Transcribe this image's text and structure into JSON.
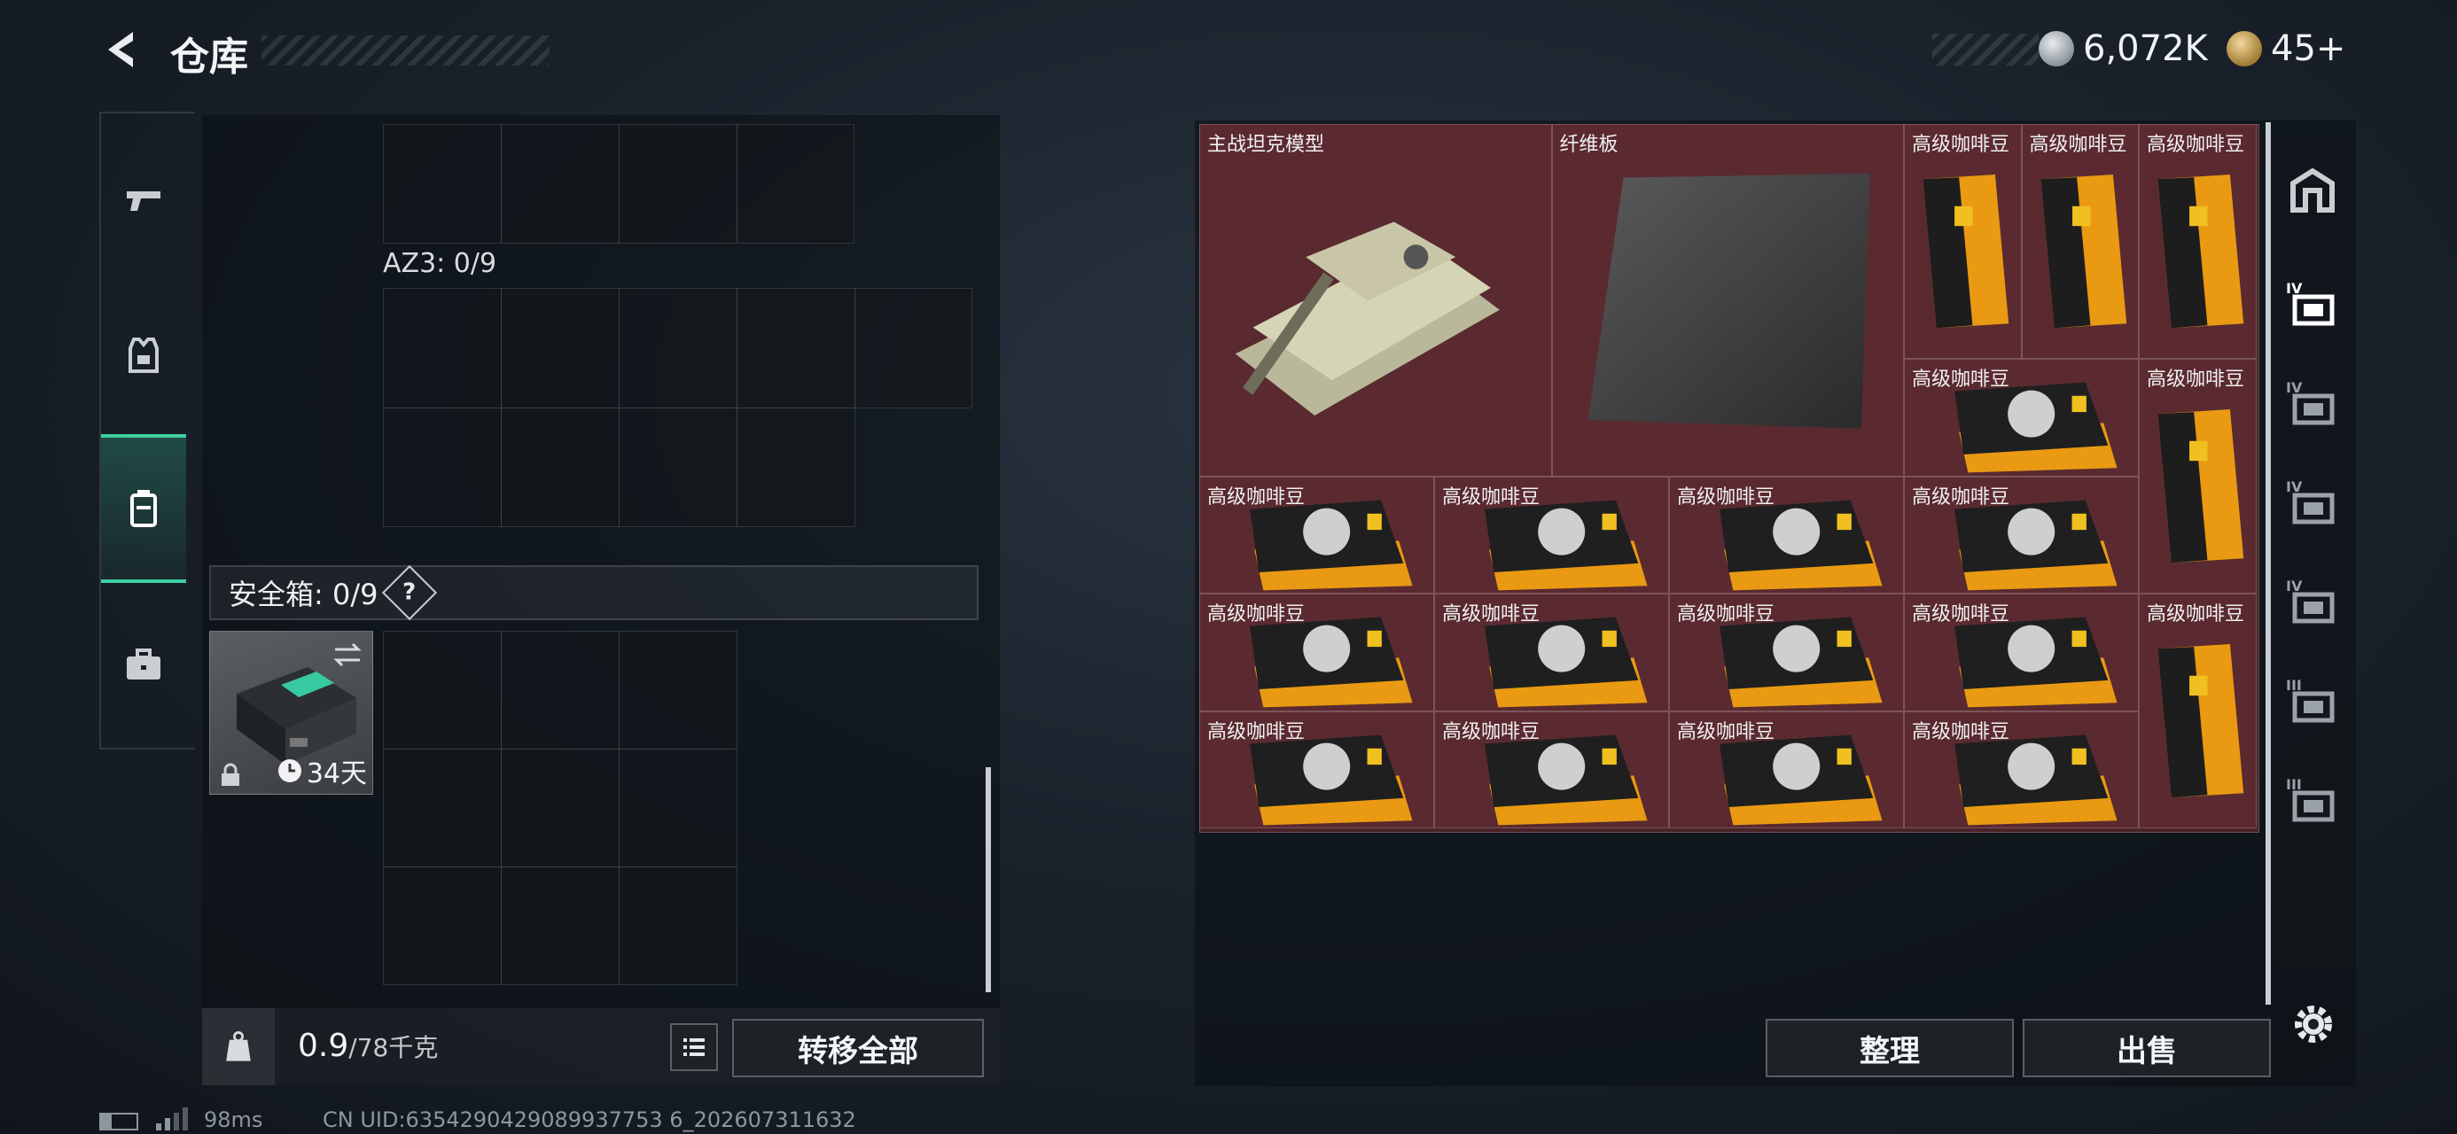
{
  "header": {
    "title": "仓库"
  },
  "currency": {
    "money": "6,072K",
    "tickets": "45+"
  },
  "left": {
    "az3_label": "AZ3: 0/9",
    "safe_box_label": "安全箱: 0/9",
    "safe_box_help": "?",
    "safe_box_days": "34天",
    "weight_value": "0.9",
    "weight_max": "/78千克",
    "weight_icon_text": "KG",
    "transfer_all": "转移全部"
  },
  "right": {
    "items": [
      {
        "name": "主战坦克模型",
        "kind": "tank"
      },
      {
        "name": "纤维板",
        "kind": "board"
      },
      {
        "name": "高级咖啡豆",
        "kind": "bag"
      },
      {
        "name": "高级咖啡豆",
        "kind": "bag"
      },
      {
        "name": "高级咖啡豆",
        "kind": "bag"
      },
      {
        "name": "高级咖啡豆",
        "kind": "pack"
      },
      {
        "name": "高级咖啡豆",
        "kind": "bag"
      },
      {
        "name": "高级咖啡豆",
        "kind": "pack"
      },
      {
        "name": "高级咖啡豆",
        "kind": "pack"
      },
      {
        "name": "高级咖啡豆",
        "kind": "pack"
      },
      {
        "name": "高级咖啡豆",
        "kind": "pack"
      },
      {
        "name": "高级咖啡豆",
        "kind": "pack"
      },
      {
        "name": "高级咖啡豆",
        "kind": "pack"
      },
      {
        "name": "高级咖啡豆",
        "kind": "pack"
      },
      {
        "name": "高级咖啡豆",
        "kind": "pack"
      },
      {
        "name": "高级咖啡豆",
        "kind": "bag"
      },
      {
        "name": "高级咖啡豆",
        "kind": "pack"
      },
      {
        "name": "高级咖啡豆",
        "kind": "pack"
      },
      {
        "name": "高级咖啡豆",
        "kind": "pack"
      },
      {
        "name": "高级咖啡豆",
        "kind": "pack"
      }
    ],
    "tabs": [
      "IV",
      "IV",
      "IV",
      "IV",
      "III",
      "III"
    ],
    "sort_button": "整理",
    "sell_button": "出售"
  },
  "status": {
    "ping": "98ms",
    "uid": "CN UID:6354290429089937753 6_202607311632"
  },
  "colors": {
    "item_bg": "#5a2a30",
    "accent": "#3fd0a0"
  }
}
